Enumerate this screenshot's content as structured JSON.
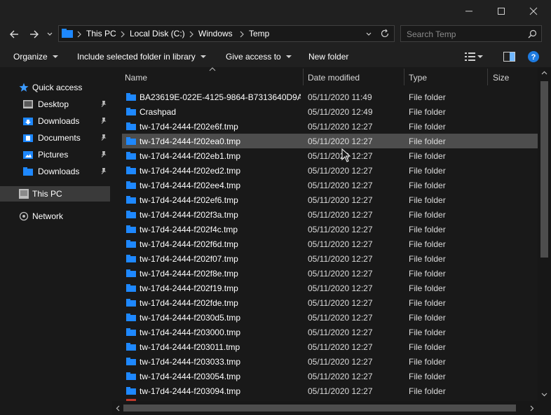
{
  "window": {
    "minimize_icon": "minimize-icon",
    "maximize_icon": "maximize-icon",
    "close_icon": "close-icon"
  },
  "address": {
    "crumbs": [
      "This PC",
      "Local Disk (C:)",
      "Windows",
      "Temp"
    ],
    "search_placeholder": "Search Temp"
  },
  "toolbar": {
    "organize": "Organize",
    "include_library": "Include selected folder in library",
    "give_access": "Give access to",
    "new_folder": "New folder"
  },
  "nav": {
    "quick_access": "Quick access",
    "items": [
      {
        "label": "Desktop",
        "icon": "desktop-icon",
        "pinned": true
      },
      {
        "label": "Downloads",
        "icon": "downloads-icon",
        "pinned": true
      },
      {
        "label": "Documents",
        "icon": "documents-icon",
        "pinned": true
      },
      {
        "label": "Pictures",
        "icon": "pictures-icon",
        "pinned": true
      },
      {
        "label": "Downloads",
        "icon": "folder-icon",
        "pinned": true
      }
    ],
    "this_pc": "This PC",
    "network": "Network"
  },
  "columns": {
    "name": "Name",
    "date": "Date modified",
    "type": "Type",
    "size": "Size"
  },
  "files": [
    {
      "name": "BA23619E-022E-4125-9864-B7313640D9A...",
      "date": "05/11/2020 11:49",
      "type": "File folder"
    },
    {
      "name": "Crashpad",
      "date": "05/11/2020 12:49",
      "type": "File folder"
    },
    {
      "name": "tw-17d4-2444-f202e6f.tmp",
      "date": "05/11/2020 12:27",
      "type": "File folder"
    },
    {
      "name": "tw-17d4-2444-f202ea0.tmp",
      "date": "05/11/2020 12:27",
      "type": "File folder",
      "selected": true
    },
    {
      "name": "tw-17d4-2444-f202eb1.tmp",
      "date": "05/11/2020 12:27",
      "type": "File folder"
    },
    {
      "name": "tw-17d4-2444-f202ed2.tmp",
      "date": "05/11/2020 12:27",
      "type": "File folder"
    },
    {
      "name": "tw-17d4-2444-f202ee4.tmp",
      "date": "05/11/2020 12:27",
      "type": "File folder"
    },
    {
      "name": "tw-17d4-2444-f202ef6.tmp",
      "date": "05/11/2020 12:27",
      "type": "File folder"
    },
    {
      "name": "tw-17d4-2444-f202f3a.tmp",
      "date": "05/11/2020 12:27",
      "type": "File folder"
    },
    {
      "name": "tw-17d4-2444-f202f4c.tmp",
      "date": "05/11/2020 12:27",
      "type": "File folder"
    },
    {
      "name": "tw-17d4-2444-f202f6d.tmp",
      "date": "05/11/2020 12:27",
      "type": "File folder"
    },
    {
      "name": "tw-17d4-2444-f202f07.tmp",
      "date": "05/11/2020 12:27",
      "type": "File folder"
    },
    {
      "name": "tw-17d4-2444-f202f8e.tmp",
      "date": "05/11/2020 12:27",
      "type": "File folder"
    },
    {
      "name": "tw-17d4-2444-f202f19.tmp",
      "date": "05/11/2020 12:27",
      "type": "File folder"
    },
    {
      "name": "tw-17d4-2444-f202fde.tmp",
      "date": "05/11/2020 12:27",
      "type": "File folder"
    },
    {
      "name": "tw-17d4-2444-f2030d5.tmp",
      "date": "05/11/2020 12:27",
      "type": "File folder"
    },
    {
      "name": "tw-17d4-2444-f203000.tmp",
      "date": "05/11/2020 12:27",
      "type": "File folder"
    },
    {
      "name": "tw-17d4-2444-f203011.tmp",
      "date": "05/11/2020 12:27",
      "type": "File folder"
    },
    {
      "name": "tw-17d4-2444-f203033.tmp",
      "date": "05/11/2020 12:27",
      "type": "File folder"
    },
    {
      "name": "tw-17d4-2444-f203054.tmp",
      "date": "05/11/2020 12:27",
      "type": "File folder"
    },
    {
      "name": "tw-17d4-2444-f203094.tmp",
      "date": "05/11/2020 12:27",
      "type": "File folder"
    }
  ],
  "colors": {
    "folder": "#1e88ff",
    "background": "#191919",
    "chrome": "#202020",
    "selected_row": "#4d4d4d",
    "help": "#1e7be0"
  }
}
